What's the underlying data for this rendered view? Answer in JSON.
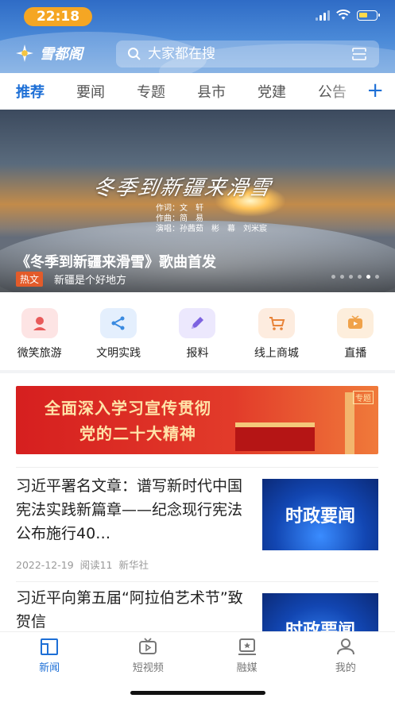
{
  "status_bar": {
    "time": "22:18"
  },
  "header": {
    "logo_text": "雪都阁",
    "search_placeholder": "大家都在搜"
  },
  "tabs": [
    {
      "label": "推荐",
      "active": true
    },
    {
      "label": "要闻"
    },
    {
      "label": "专题"
    },
    {
      "label": "县市"
    },
    {
      "label": "党建"
    },
    {
      "label": "公告"
    }
  ],
  "banner": {
    "art_title": "冬季到新疆来滑雪",
    "credits": [
      "作词：文　轩",
      "作曲：简　易",
      "演唱：孙茜茹　彬　幕　刘米宸"
    ],
    "title": "《冬季到新疆来滑雪》歌曲首发",
    "tag": "热文",
    "subtitle": "新疆是个好地方",
    "slide_count": 6,
    "active_slide": 5
  },
  "quick_links": [
    {
      "label": "微笑旅游",
      "icon": "smile-travel-icon",
      "color": "#fde4e4"
    },
    {
      "label": "文明实践",
      "icon": "share-icon",
      "color": "#e4effd"
    },
    {
      "label": "报料",
      "icon": "pencil-icon",
      "color": "#ece8fd"
    },
    {
      "label": "线上商城",
      "icon": "cart-icon",
      "color": "#fdecdf"
    },
    {
      "label": "直播",
      "icon": "tv-icon",
      "color": "#fdeedc"
    }
  ],
  "promo": {
    "line1": "全面深入学习宣传贯彻",
    "line2": "党的二十大精神",
    "badge": "专题"
  },
  "articles": [
    {
      "title": "习近平署名文章：谱写新时代中国宪法实践新篇章——纪念现行宪法公布施行40…",
      "date": "2022-12-19",
      "reads": "阅读11",
      "source": "新华社",
      "thumb_text": "时政要闻"
    },
    {
      "title": "习近平向第五届“阿拉伯艺术节”致贺信",
      "thumb_text": "时政要闻"
    }
  ],
  "bottom_nav": [
    {
      "label": "新闻",
      "icon": "news-icon",
      "active": true
    },
    {
      "label": "短视频",
      "icon": "video-icon"
    },
    {
      "label": "融媒",
      "icon": "media-icon"
    },
    {
      "label": "我的",
      "icon": "profile-icon"
    }
  ],
  "colors": {
    "accent": "#1d6fd6",
    "hot_tag": "#e35b2a",
    "status_time_bg": "#f5a623"
  }
}
